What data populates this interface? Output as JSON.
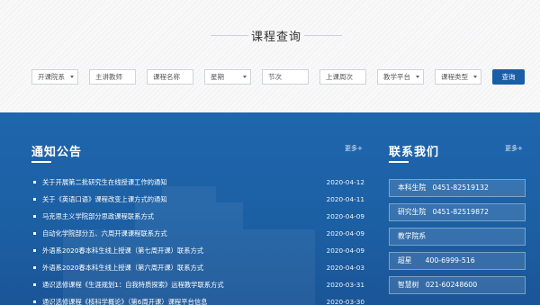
{
  "search": {
    "title": "课程查询",
    "filters": [
      {
        "label": "开课院系",
        "dropdown": true
      },
      {
        "label": "主讲教师",
        "dropdown": false
      },
      {
        "label": "课程名称",
        "dropdown": false
      },
      {
        "label": "星期",
        "dropdown": true
      },
      {
        "label": "节次",
        "dropdown": false
      },
      {
        "label": "上课周次",
        "dropdown": false
      },
      {
        "label": "教学平台",
        "dropdown": true
      },
      {
        "label": "课程类型",
        "dropdown": true
      }
    ],
    "query_button": "查询"
  },
  "notices": {
    "title": "通知公告",
    "more": "更多+",
    "items": [
      {
        "title": "关于开展第二批研究生在线授课工作的通知",
        "date": "2020-04-12"
      },
      {
        "title": "关于《英语口语》课程改变上课方式的通知",
        "date": "2020-04-11"
      },
      {
        "title": "马克思主义学院部分思政课程联系方式",
        "date": "2020-04-09"
      },
      {
        "title": "自动化学院部分五、六周开课课程联系方式",
        "date": "2020-04-09"
      },
      {
        "title": "外语系2020春本科生线上授课（第七周开课）联系方式",
        "date": "2020-04-09"
      },
      {
        "title": "外语系2020春本科生线上授课（第六周开课）联系方式",
        "date": "2020-04-03"
      },
      {
        "title": "通识选修课程《生涯规划1：自我特质探索》远程教学联系方式",
        "date": "2020-03-31"
      },
      {
        "title": "通识选修课程《核科学概论》（第6周开课）课程平台信息",
        "date": "2020-03-30"
      }
    ]
  },
  "contacts": {
    "title": "联系我们",
    "more": "更多+",
    "items": [
      {
        "label": "本科生院",
        "phone": "0451-82519132"
      },
      {
        "label": "研究生院",
        "phone": "0451-82519872"
      },
      {
        "label": "教学院系",
        "phone": ""
      },
      {
        "label": "超星",
        "phone": "400-6999-516"
      },
      {
        "label": "智慧树",
        "phone": "021-60248600"
      }
    ]
  }
}
